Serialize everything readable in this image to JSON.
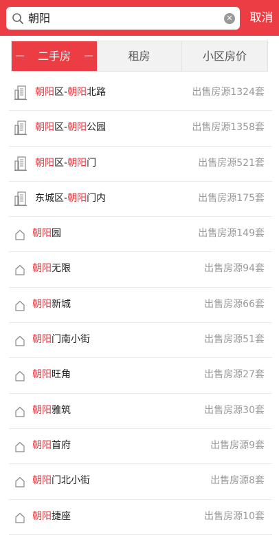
{
  "search": {
    "query": "朝阳",
    "cancel_label": "取消"
  },
  "tabs": [
    {
      "label": "二手房",
      "active": true
    },
    {
      "label": "租房",
      "active": false
    },
    {
      "label": "小区房价",
      "active": false
    }
  ],
  "colors": {
    "accent": "#ec3c44",
    "highlight": "#e0353d",
    "muted": "#999999"
  },
  "results": [
    {
      "icon": "building-icon",
      "parts": [
        {
          "t": "朝阳",
          "h": true
        },
        {
          "t": "区-",
          "h": false
        },
        {
          "t": "朝阳",
          "h": true
        },
        {
          "t": "北路",
          "h": false
        }
      ],
      "count": "出售房源1324套"
    },
    {
      "icon": "building-icon",
      "parts": [
        {
          "t": "朝阳",
          "h": true
        },
        {
          "t": "区-",
          "h": false
        },
        {
          "t": "朝阳",
          "h": true
        },
        {
          "t": "公园",
          "h": false
        }
      ],
      "count": "出售房源1358套"
    },
    {
      "icon": "building-icon",
      "parts": [
        {
          "t": "朝阳",
          "h": true
        },
        {
          "t": "区-",
          "h": false
        },
        {
          "t": "朝阳",
          "h": true
        },
        {
          "t": "门",
          "h": false
        }
      ],
      "count": "出售房源521套"
    },
    {
      "icon": "building-icon",
      "parts": [
        {
          "t": "东城区-",
          "h": false
        },
        {
          "t": "朝阳",
          "h": true
        },
        {
          "t": "门内",
          "h": false
        }
      ],
      "count": "出售房源175套"
    },
    {
      "icon": "house-icon",
      "parts": [
        {
          "t": "朝阳",
          "h": true
        },
        {
          "t": "园",
          "h": false
        }
      ],
      "count": "出售房源149套"
    },
    {
      "icon": "house-icon",
      "parts": [
        {
          "t": "朝阳",
          "h": true
        },
        {
          "t": "无限",
          "h": false
        }
      ],
      "count": "出售房源94套"
    },
    {
      "icon": "house-icon",
      "parts": [
        {
          "t": "朝阳",
          "h": true
        },
        {
          "t": "新城",
          "h": false
        }
      ],
      "count": "出售房源66套"
    },
    {
      "icon": "house-icon",
      "parts": [
        {
          "t": "朝阳",
          "h": true
        },
        {
          "t": "门南小街",
          "h": false
        }
      ],
      "count": "出售房源51套"
    },
    {
      "icon": "house-icon",
      "parts": [
        {
          "t": "朝阳",
          "h": true
        },
        {
          "t": "旺角",
          "h": false
        }
      ],
      "count": "出售房源27套"
    },
    {
      "icon": "house-icon",
      "parts": [
        {
          "t": "朝阳",
          "h": true
        },
        {
          "t": "雅筑",
          "h": false
        }
      ],
      "count": "出售房源30套"
    },
    {
      "icon": "house-icon",
      "parts": [
        {
          "t": "朝阳",
          "h": true
        },
        {
          "t": "首府",
          "h": false
        }
      ],
      "count": "出售房源9套"
    },
    {
      "icon": "house-icon",
      "parts": [
        {
          "t": "朝阳",
          "h": true
        },
        {
          "t": "门北小街",
          "h": false
        }
      ],
      "count": "出售房源8套"
    },
    {
      "icon": "house-icon",
      "parts": [
        {
          "t": "朝阳",
          "h": true
        },
        {
          "t": "捷座",
          "h": false
        }
      ],
      "count": "出售房源10套"
    }
  ]
}
